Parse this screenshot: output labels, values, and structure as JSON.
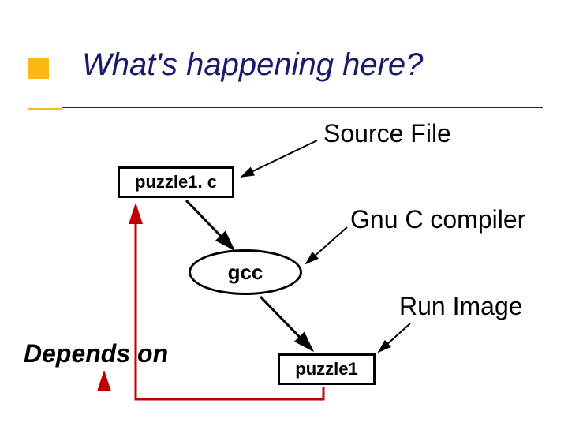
{
  "title": "What's happening here?",
  "labels": {
    "source_file": "Source File",
    "gnu_compiler": "Gnu C compiler",
    "run_image": "Run Image",
    "depends_on": "Depends on"
  },
  "nodes": {
    "puzzle1c": "puzzle1. c",
    "gcc": "gcc",
    "puzzle1": "puzzle1"
  }
}
